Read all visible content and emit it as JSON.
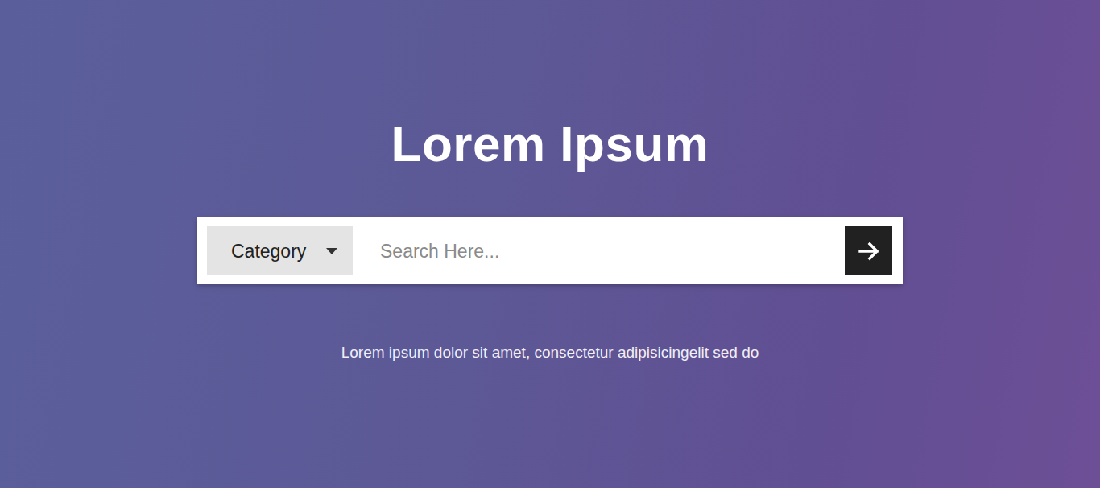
{
  "hero": {
    "title": "Lorem Ipsum",
    "subtitle": "Lorem ipsum dolor sit amet, consectetur adipisicingelit sed do"
  },
  "search": {
    "category": "Category",
    "placeholder": "Search Here..."
  }
}
